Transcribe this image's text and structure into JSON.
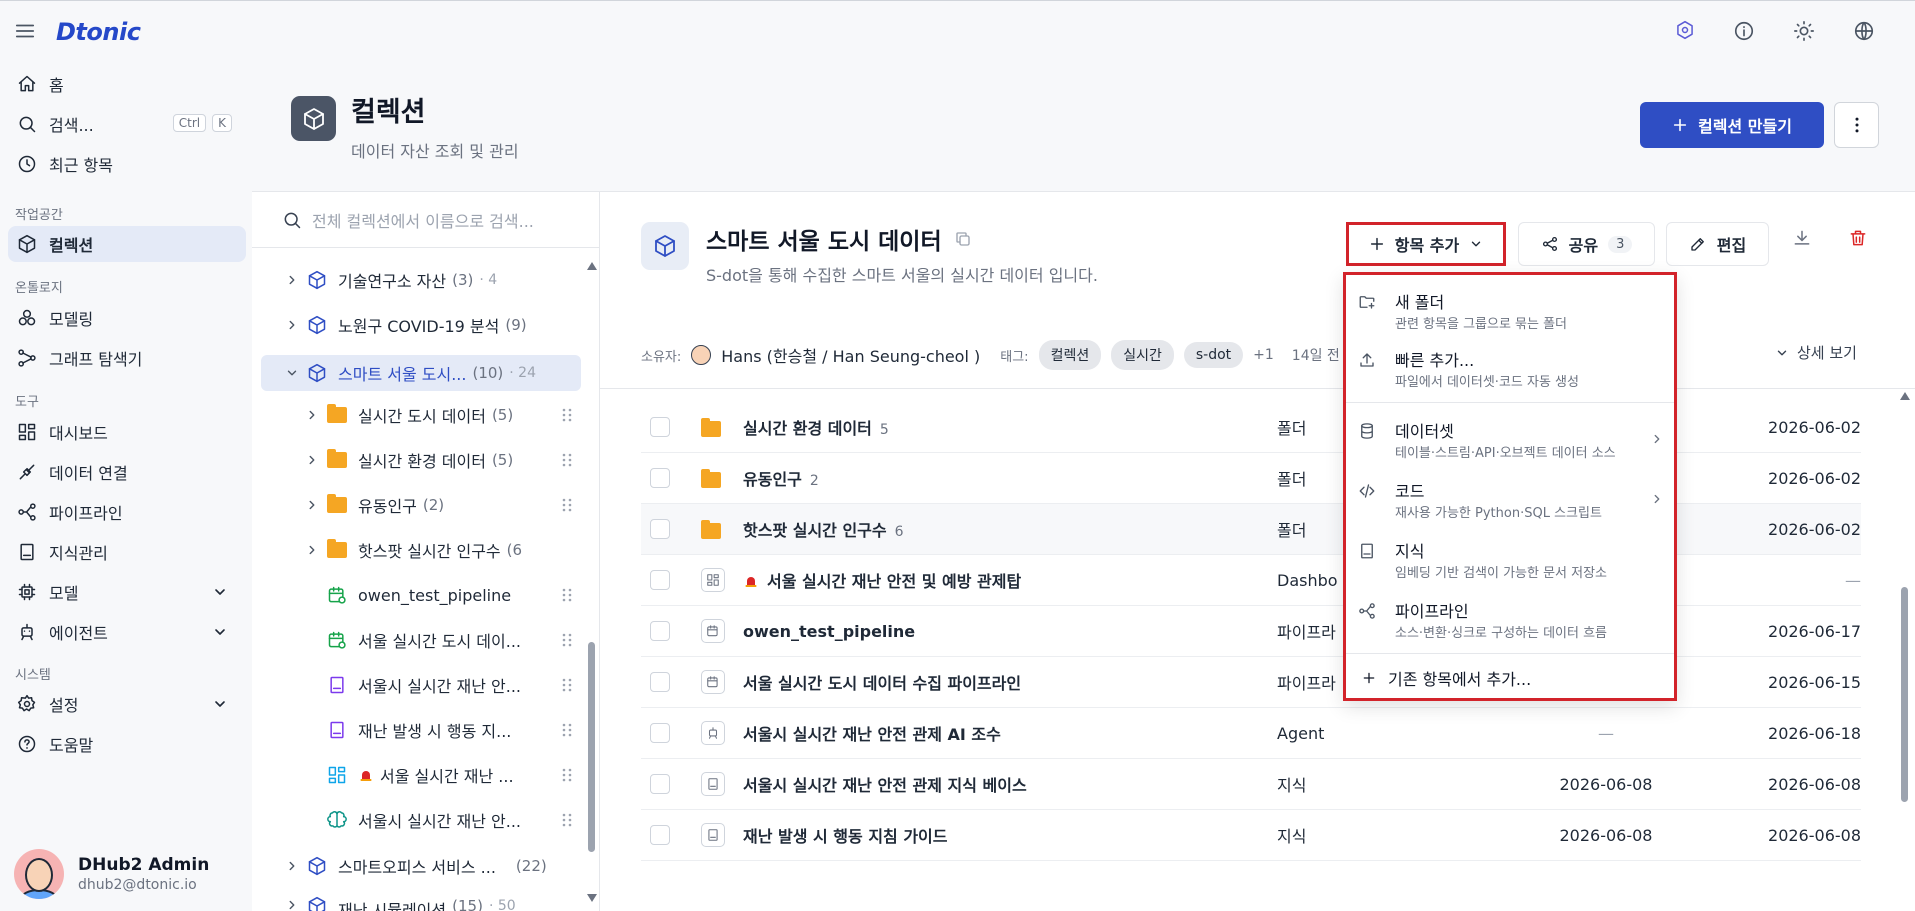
{
  "app": {
    "logo": "Dtonic"
  },
  "sidebar": {
    "items": [
      {
        "label": "홈"
      },
      {
        "label": "검색...",
        "shortcut": [
          "Ctrl",
          "K"
        ]
      },
      {
        "label": "최근 항목"
      }
    ],
    "sections": {
      "workspace": "작업공간",
      "ontology": "온톨로지",
      "tools": "도구",
      "system": "시스템"
    },
    "workspace_items": [
      {
        "label": "컬렉션"
      }
    ],
    "ontology_items": [
      {
        "label": "모델링"
      },
      {
        "label": "그래프 탐색기"
      }
    ],
    "tool_items": [
      {
        "label": "대시보드"
      },
      {
        "label": "데이터 연결"
      },
      {
        "label": "파이프라인"
      },
      {
        "label": "지식관리"
      },
      {
        "label": "모델"
      },
      {
        "label": "에이전트"
      }
    ],
    "system_items": [
      {
        "label": "설정"
      },
      {
        "label": "도움말"
      }
    ],
    "user": {
      "name": "DHub2 Admin",
      "email": "dhub2@dtonic.io"
    }
  },
  "header": {
    "title": "컬렉션",
    "subtitle": "데이터 자산 조회 및 관리",
    "create_button": "컬렉션 만들기"
  },
  "tree": {
    "search_placeholder": "전체 컬렉션에서 이름으로 검색...",
    "rows": [
      {
        "label": "기술연구소 자산",
        "count": "(3)",
        "extra": "· 4"
      },
      {
        "label": "노원구 COVID-19 분석",
        "count": "(9)",
        "extra": ""
      },
      {
        "label": "스마트 서울 도시...",
        "count": "(10)",
        "extra": "· 24"
      },
      {
        "label": "실시간 도시 데이터",
        "count": "(5)"
      },
      {
        "label": "실시간 환경 데이터",
        "count": "(5)"
      },
      {
        "label": "유동인구",
        "count": "(2)"
      },
      {
        "label": "핫스팟 실시간 인구수",
        "count": "(6"
      },
      {
        "label": "owen_test_pipeline"
      },
      {
        "label": "서울 실시간 도시 데이..."
      },
      {
        "label": "서울시 실시간 재난 안..."
      },
      {
        "label": "재난 발생 시 행동 지..."
      },
      {
        "label": "서울 실시간 재난 ..."
      },
      {
        "label": "서울시 실시간 재난 안..."
      },
      {
        "label": "스마트오피스 서비스 ...",
        "count": "(22)"
      },
      {
        "label": "재난 시뮬레이션",
        "count": "(15)",
        "extra": "· 50"
      }
    ]
  },
  "detail": {
    "title": "스마트 서울 도시 데이터",
    "description": "S-dot을 통해 수집한 스마트 서울의 실시간 데이터 입니다.",
    "add_button": "항목 추가",
    "share_button": "공유",
    "share_count": "3",
    "edit_button": "편집",
    "owner_label": "소유자:",
    "owner": "Hans (한승철 / Han Seung-cheol )",
    "tags_label": "태그:",
    "tags": [
      "컬렉션",
      "실시간",
      "s-dot"
    ],
    "tags_more": "+1",
    "date_text": "14일 전",
    "detail_view": "상세 보기"
  },
  "table": {
    "rows": [
      {
        "name": "실시간 환경 데이터",
        "count": "5",
        "type": "폴더",
        "col1": "",
        "col2": "2026-06-02"
      },
      {
        "name": "유동인구",
        "count": "2",
        "type": "폴더",
        "col1": "",
        "col2": "2026-06-02"
      },
      {
        "name": "핫스팟 실시간 인구수",
        "count": "6",
        "type": "폴더",
        "col1": "",
        "col2": "2026-06-02"
      },
      {
        "name": "서울 실시간 재난 안전 및 예방 관제탑",
        "count": "",
        "type": "Dashbo",
        "col1": "",
        "col2": "—"
      },
      {
        "name": "owen_test_pipeline",
        "count": "",
        "type": "파이프라",
        "col1": "",
        "col2": "2026-06-17"
      },
      {
        "name": "서울 실시간 도시 데이터 수집 파이프라인",
        "count": "",
        "type": "파이프라",
        "col1": "",
        "col2": "2026-06-15"
      },
      {
        "name": "서울시 실시간 재난 안전 관제 AI 조수",
        "count": "",
        "type": "Agent",
        "col1": "—",
        "col2": "2026-06-18"
      },
      {
        "name": "서울시 실시간 재난 안전 관제 지식 베이스",
        "count": "",
        "type": "지식",
        "col1": "2026-06-08",
        "col2": "2026-06-08"
      },
      {
        "name": "재난 발생 시 행동 지침 가이드",
        "count": "",
        "type": "지식",
        "col1": "2026-06-08",
        "col2": "2026-06-08"
      }
    ]
  },
  "menu": {
    "items": [
      {
        "title": "새 폴더",
        "desc": "관련 항목을 그룹으로 묶는 폴더"
      },
      {
        "title": "빠른 추가...",
        "desc": "파일에서 데이터셋·코드 자동 생성"
      },
      {
        "title": "데이터셋",
        "desc": "테이블·스트림·API·오브젝트 데이터 소스"
      },
      {
        "title": "코드",
        "desc": "재사용 가능한 Python·SQL 스크립트"
      },
      {
        "title": "지식",
        "desc": "임베딩 기반 검색이 가능한 문서 저장소"
      },
      {
        "title": "파이프라인",
        "desc": "소스·변환·싱크로 구성하는 데이터 흐름"
      }
    ],
    "footer": "기존 항목에서 추가..."
  },
  "colors": {
    "primary": "#2f4ec4",
    "highlight_border": "#d2232a",
    "folder": "#f5a623",
    "selected_bg": "#e4eaf7"
  }
}
